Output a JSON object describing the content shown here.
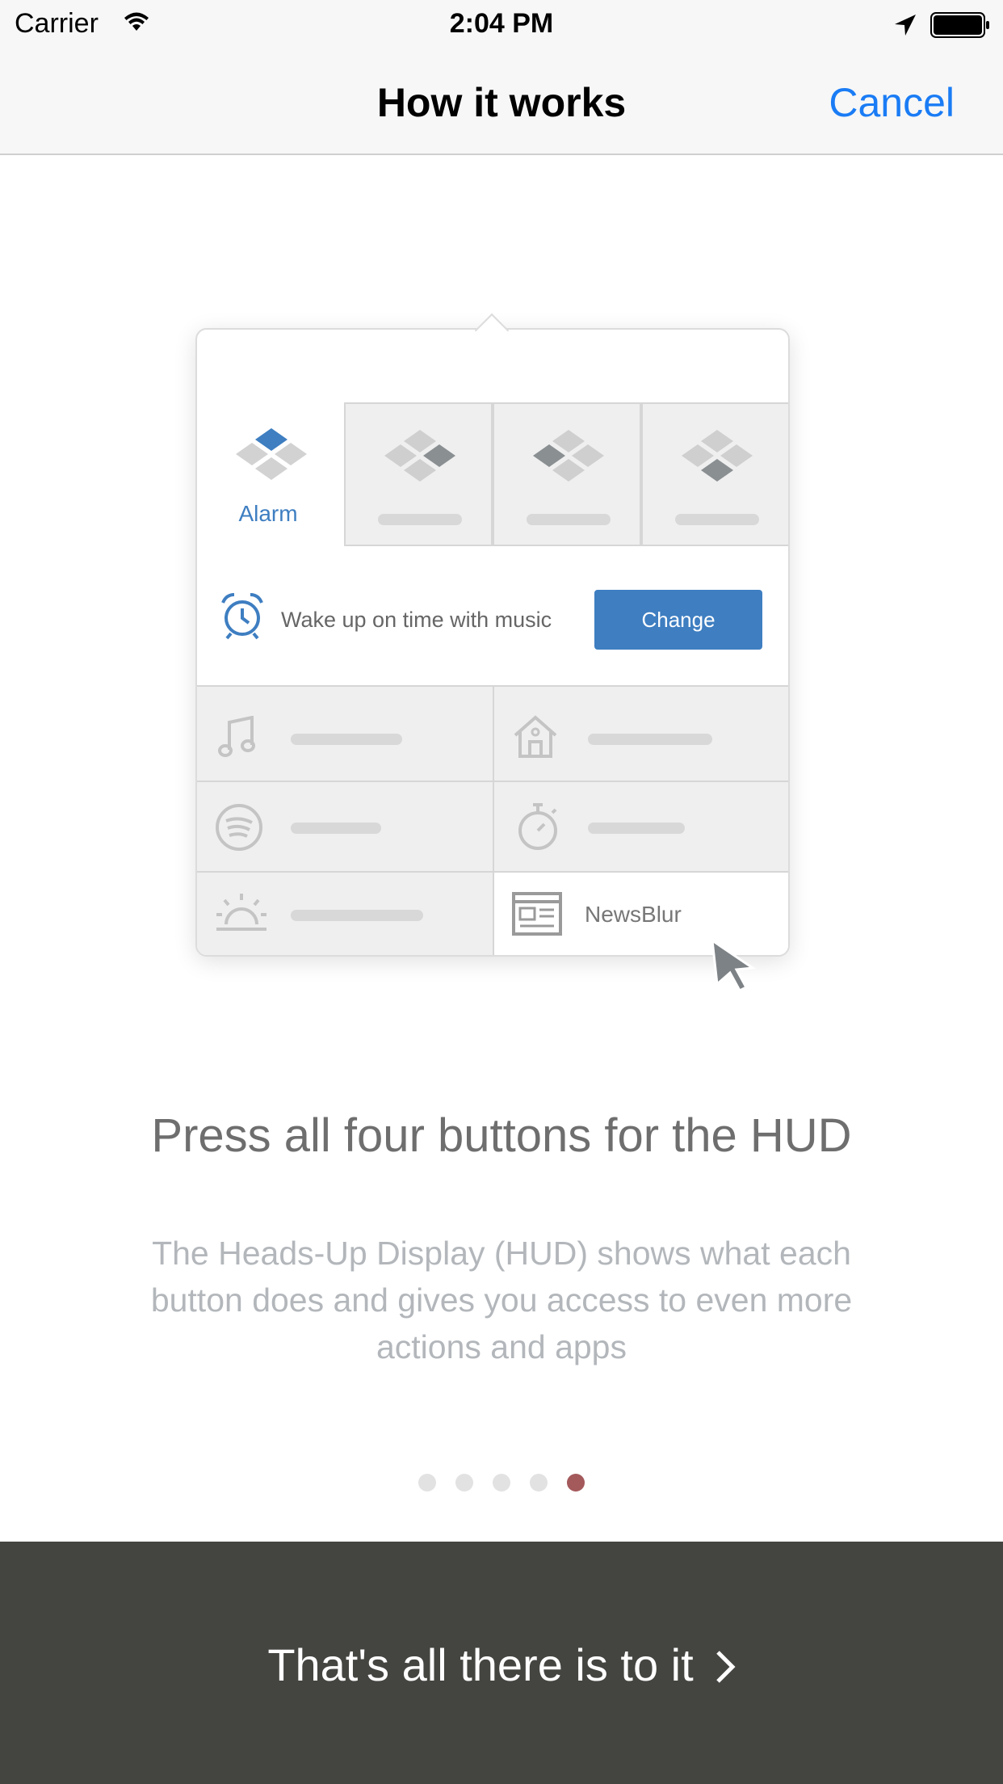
{
  "status_bar": {
    "carrier": "Carrier",
    "time": "2:04 PM",
    "icons": [
      "wifi-icon",
      "location-arrow-icon",
      "battery-icon"
    ]
  },
  "nav": {
    "title": "How it works",
    "cancel_label": "Cancel"
  },
  "hud": {
    "active_tab_label": "Alarm",
    "row_text": "Wake up on time with music",
    "change_label": "Change",
    "grid_icons": [
      "music-note-icon",
      "home-icon",
      "spotify-icon",
      "stopwatch-icon",
      "sunrise-icon",
      "news-icon"
    ],
    "newsblur_label": "NewsBlur"
  },
  "content": {
    "headline": "Press all four buttons for the HUD",
    "body": "The Heads-Up Display (HUD) shows what each button does and gives you access to even more actions and apps"
  },
  "pager": {
    "count": 5,
    "active_index": 4
  },
  "footer": {
    "button_label": "That's all there is to it"
  },
  "colors": {
    "accent_blue": "#1a7cf5",
    "hud_blue": "#3e7ec1",
    "active_dot": "#a4595b",
    "footer_bg": "#444441"
  }
}
